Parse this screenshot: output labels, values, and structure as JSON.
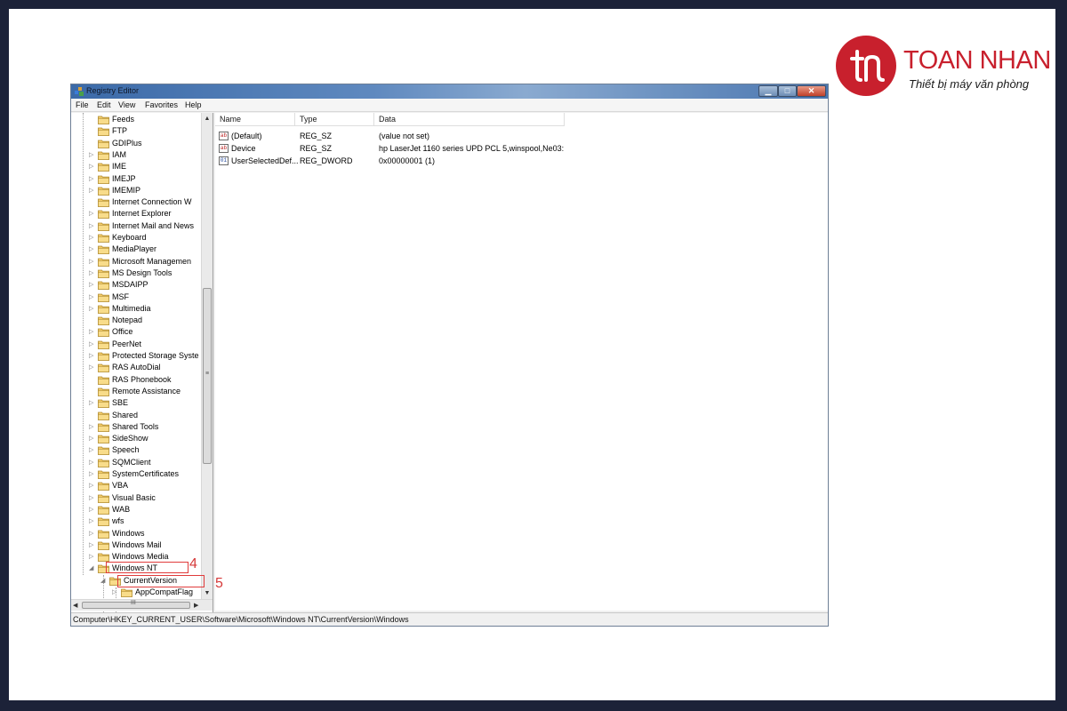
{
  "brand": {
    "name": "TOAN NHAN",
    "tagline": "Thiết bị máy văn phòng",
    "color": "#c8202d",
    "icon": "tn-monogram-logo"
  },
  "window": {
    "title": "Registry Editor",
    "icon": "registry-editor-icon",
    "controls": {
      "minimize": "minimize-icon",
      "maximize": "maximize-icon",
      "close": "close-icon"
    }
  },
  "menu": [
    "File",
    "Edit",
    "View",
    "Favorites",
    "Help"
  ],
  "tree": {
    "items": [
      {
        "label": "Feeds",
        "expandable": false
      },
      {
        "label": "FTP",
        "expandable": false
      },
      {
        "label": "GDIPlus",
        "expandable": false
      },
      {
        "label": "IAM",
        "expandable": true
      },
      {
        "label": "IME",
        "expandable": true
      },
      {
        "label": "IMEJP",
        "expandable": true
      },
      {
        "label": "IMEMIP",
        "expandable": true
      },
      {
        "label": "Internet Connection W",
        "expandable": false
      },
      {
        "label": "Internet Explorer",
        "expandable": true
      },
      {
        "label": "Internet Mail and News",
        "expandable": true
      },
      {
        "label": "Keyboard",
        "expandable": true
      },
      {
        "label": "MediaPlayer",
        "expandable": true
      },
      {
        "label": "Microsoft Managemen",
        "expandable": true
      },
      {
        "label": "MS Design Tools",
        "expandable": true
      },
      {
        "label": "MSDAIPP",
        "expandable": true
      },
      {
        "label": "MSF",
        "expandable": true
      },
      {
        "label": "Multimedia",
        "expandable": true
      },
      {
        "label": "Notepad",
        "expandable": false
      },
      {
        "label": "Office",
        "expandable": true
      },
      {
        "label": "PeerNet",
        "expandable": true
      },
      {
        "label": "Protected Storage Syste",
        "expandable": true
      },
      {
        "label": "RAS AutoDial",
        "expandable": true
      },
      {
        "label": "RAS Phonebook",
        "expandable": false
      },
      {
        "label": "Remote Assistance",
        "expandable": false
      },
      {
        "label": "SBE",
        "expandable": true
      },
      {
        "label": "Shared",
        "expandable": false
      },
      {
        "label": "Shared Tools",
        "expandable": true
      },
      {
        "label": "SideShow",
        "expandable": true
      },
      {
        "label": "Speech",
        "expandable": true
      },
      {
        "label": "SQMClient",
        "expandable": true
      },
      {
        "label": "SystemCertificates",
        "expandable": true
      },
      {
        "label": "VBA",
        "expandable": true
      },
      {
        "label": "Visual Basic",
        "expandable": true
      },
      {
        "label": "WAB",
        "expandable": true
      },
      {
        "label": "wfs",
        "expandable": true
      },
      {
        "label": "Windows",
        "expandable": true
      },
      {
        "label": "Windows Mail",
        "expandable": true
      },
      {
        "label": "Windows Media",
        "expandable": true
      },
      {
        "label": "Windows NT",
        "expandable": true,
        "expanded": true,
        "annotation": "4"
      },
      {
        "label": "CurrentVersion",
        "expandable": true,
        "expanded": true,
        "selected": true,
        "annotation": "5",
        "level": 1
      },
      {
        "label": "AppCompatFlag",
        "expandable": true,
        "level": 2
      }
    ]
  },
  "list": {
    "columns": [
      "Name",
      "Type",
      "Data"
    ],
    "rows": [
      {
        "name": "(Default)",
        "type": "REG_SZ",
        "data": "(value not set)",
        "icon": "ab"
      },
      {
        "name": "Device",
        "type": "REG_SZ",
        "data": "hp LaserJet 1160 series UPD PCL 5,winspool,Ne03:",
        "icon": "ab"
      },
      {
        "name": "UserSelectedDef...",
        "type": "REG_DWORD",
        "data": "0x00000001 (1)",
        "icon": "dword"
      }
    ]
  },
  "status": "Computer\\HKEY_CURRENT_USER\\Software\\Microsoft\\Windows NT\\CurrentVersion\\Windows",
  "annotations": {
    "box4": "4",
    "box5": "5",
    "color": "#e03b3b"
  }
}
